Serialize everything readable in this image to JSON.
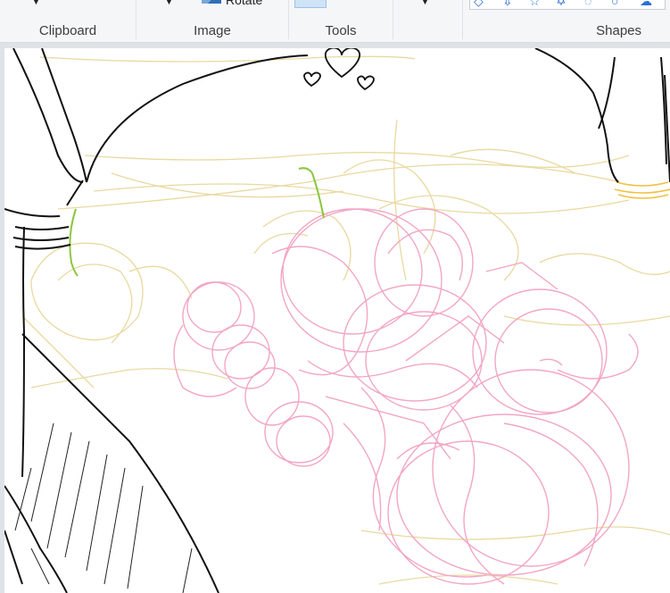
{
  "ribbon": {
    "groups": {
      "clipboard": "Clipboard",
      "image": "Image",
      "tools": "Tools",
      "shapes": "Shapes"
    },
    "rotate_label": "Rotate"
  },
  "colors": {
    "ribbon_bg": "#f5f6f7",
    "canvas_bg": "#ffffff",
    "workspace_bg": "#dfe3e8",
    "sketch_black": "#111111",
    "sketch_pink": "#f2a6c4",
    "sketch_yellow": "#e8d9a0",
    "sketch_green": "#8cc63f",
    "sketch_gold": "#f0c040"
  },
  "icons": [
    "rotate-icon",
    "dropdown-caret-icon",
    "shapes-gallery-icon"
  ]
}
